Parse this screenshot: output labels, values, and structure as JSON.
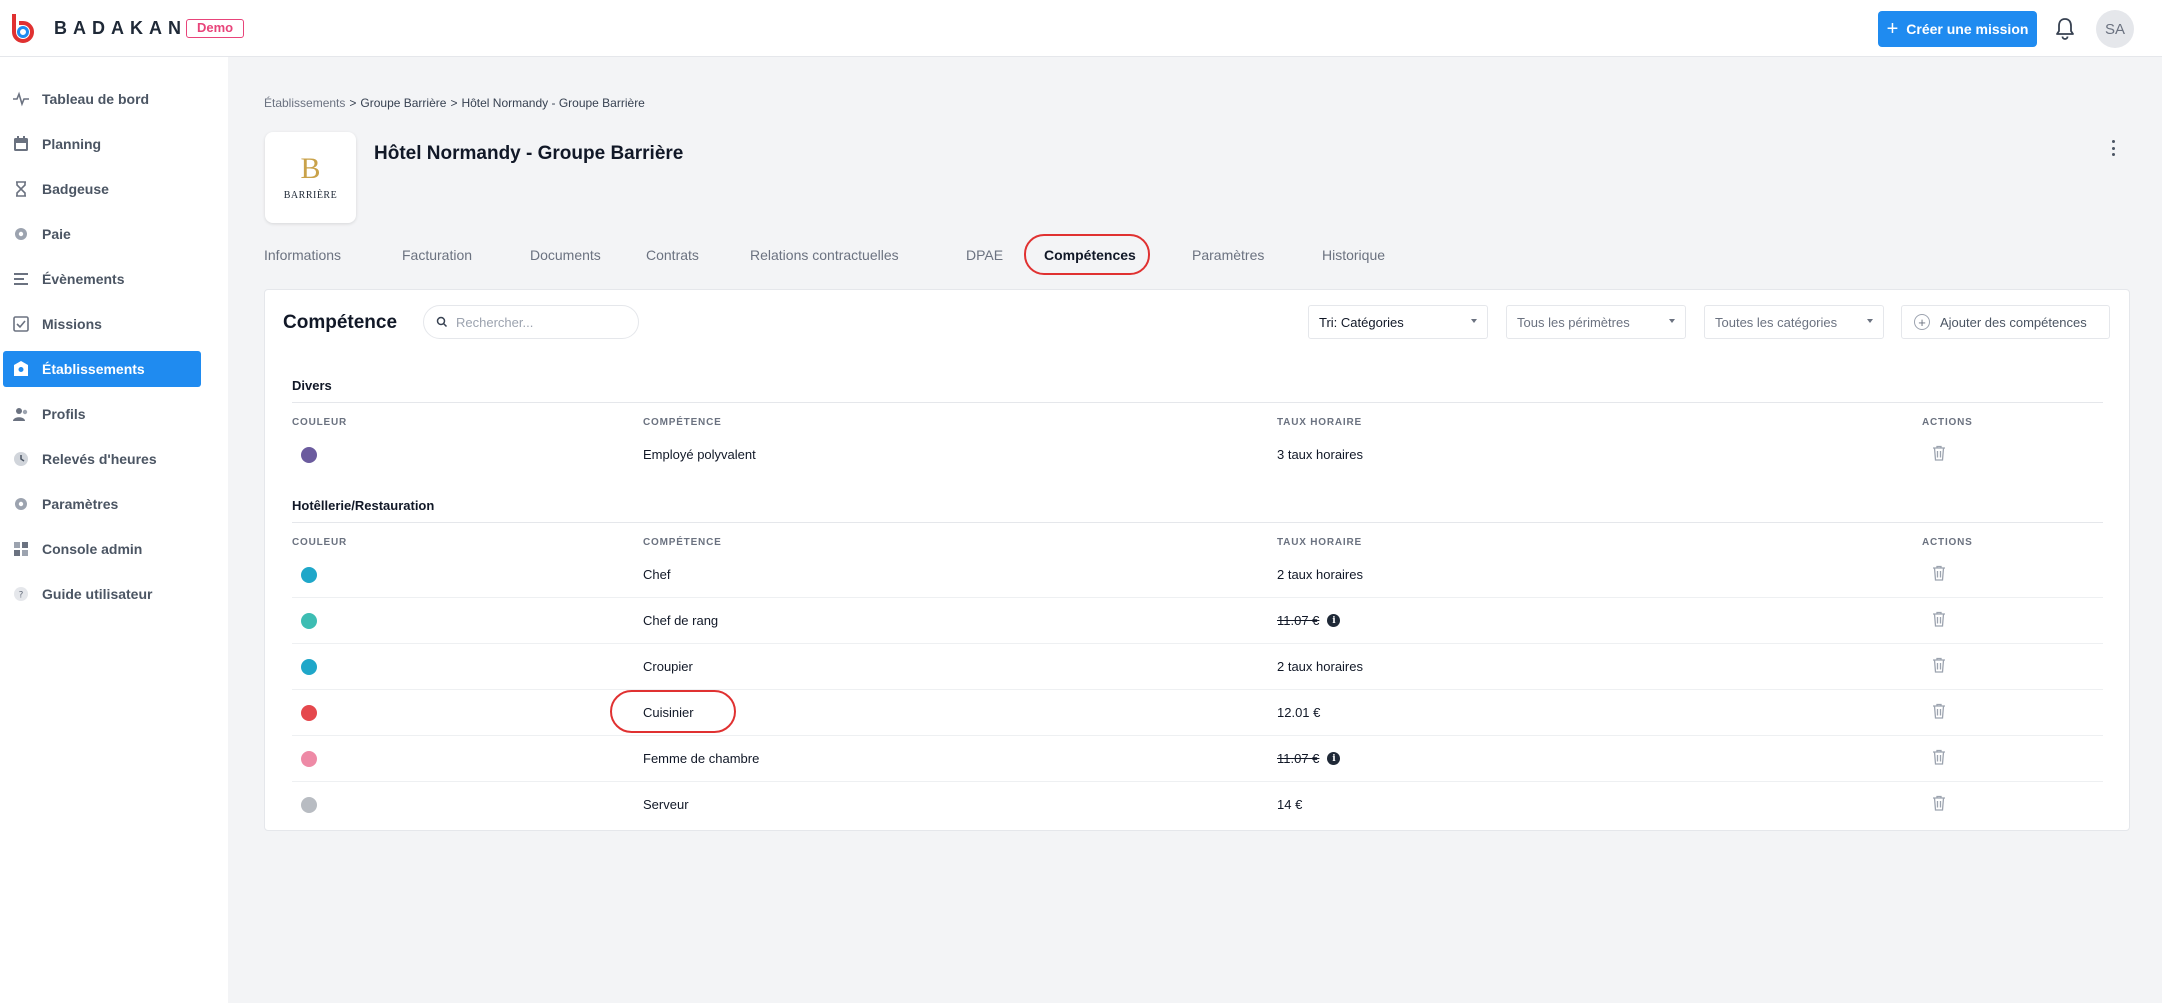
{
  "brand": {
    "name": "BADAKAN",
    "badge": "Demo",
    "accent": "#1f8bf0",
    "logo_color": "#e03131"
  },
  "topbar": {
    "create_label": "Créer une mission",
    "avatar_initials": "SA"
  },
  "sidebar": {
    "items": [
      {
        "label": "Tableau de bord",
        "icon": "activity-icon"
      },
      {
        "label": "Planning",
        "icon": "calendar-icon"
      },
      {
        "label": "Badgeuse",
        "icon": "hourglass-icon"
      },
      {
        "label": "Paie",
        "icon": "gear-icon"
      },
      {
        "label": "Évènements",
        "icon": "list-icon"
      },
      {
        "label": "Missions",
        "icon": "checklist-icon"
      },
      {
        "label": "Établissements",
        "icon": "building-icon",
        "active": true
      },
      {
        "label": "Profils",
        "icon": "users-icon"
      },
      {
        "label": "Relevés d'heures",
        "icon": "clock-icon"
      },
      {
        "label": "Paramètres",
        "icon": "gear-icon"
      },
      {
        "label": "Console admin",
        "icon": "grid-icon"
      },
      {
        "label": "Guide utilisateur",
        "icon": "help-icon"
      }
    ]
  },
  "breadcrumb": {
    "first": "Établissements",
    "sep1": ">",
    "second": "Groupe Barrière",
    "sep2": ">",
    "third": "Hôtel Normandy - Groupe Barrière"
  },
  "org": {
    "title": "Hôtel Normandy - Groupe Barrière",
    "logo_letter": "B",
    "logo_text": "BARRIÈRE"
  },
  "tabs": [
    {
      "label": "Informations"
    },
    {
      "label": "Facturation"
    },
    {
      "label": "Documents"
    },
    {
      "label": "Contrats"
    },
    {
      "label": "Relations contractuelles"
    },
    {
      "label": "DPAE"
    },
    {
      "label": "Compétences",
      "active": true
    },
    {
      "label": "Paramètres"
    },
    {
      "label": "Historique"
    }
  ],
  "competences": {
    "title": "Compétence",
    "search_placeholder": "Rechercher...",
    "sort_select": "Tri: Catégories",
    "perimeter_select": "Tous les périmètres",
    "category_select": "Toutes les catégories",
    "add_label": "Ajouter des compétences",
    "columns": {
      "color": "COULEUR",
      "competence": "COMPÉTENCE",
      "rate": "TAUX HORAIRE",
      "actions": "ACTIONS"
    },
    "sections": [
      {
        "name": "Divers",
        "rows": [
          {
            "color": "#6b5b9e",
            "name": "Employé polyvalent",
            "rate": "3 taux horaires",
            "strike": false,
            "info": false
          }
        ]
      },
      {
        "name": "Hotêllerie/Restauration",
        "rows": [
          {
            "color": "#1fa7c9",
            "name": "Chef",
            "rate": "2 taux horaires",
            "strike": false,
            "info": false
          },
          {
            "color": "#3dbdb3",
            "name": "Chef de rang",
            "rate": "11.07 €",
            "strike": true,
            "info": true
          },
          {
            "color": "#1fa7c9",
            "name": "Croupier",
            "rate": "2 taux horaires",
            "strike": false,
            "info": false
          },
          {
            "color": "#e5484d",
            "name": "Cuisinier",
            "rate": "12.01 €",
            "strike": false,
            "info": false
          },
          {
            "color": "#ee8aa6",
            "name": "Femme de chambre",
            "rate": "11.07 €",
            "strike": true,
            "info": true
          },
          {
            "color": "#b8bcc2",
            "name": "Serveur",
            "rate": "14 €",
            "strike": false,
            "info": false
          }
        ]
      }
    ]
  }
}
